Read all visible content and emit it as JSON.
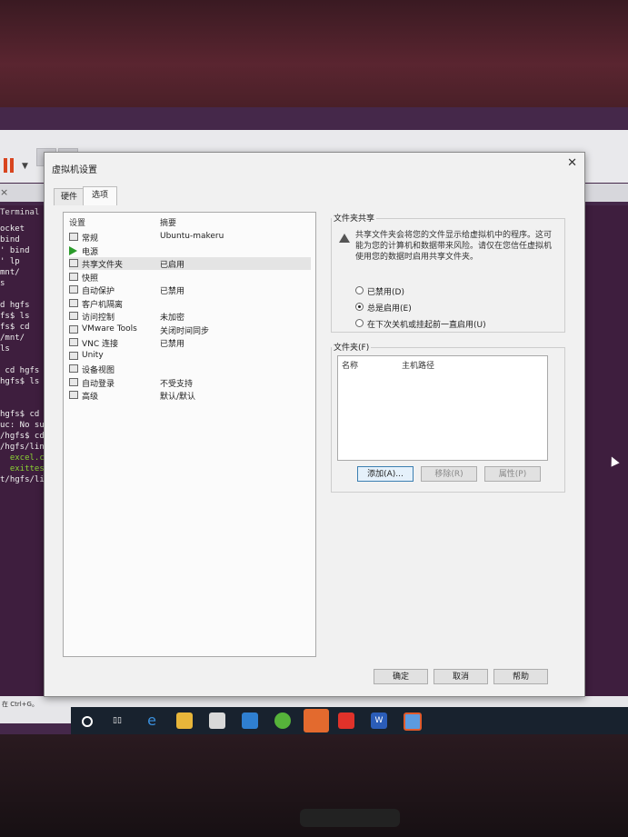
{
  "terminal": {
    "title": "Terminal  H",
    "lines": [
      {
        "text": "ocket",
        "color": "white"
      },
      {
        "text": "bind",
        "color": "white"
      },
      {
        "text": "' bind",
        "color": "white"
      },
      {
        "text": "' lp",
        "color": "white"
      },
      {
        "text": "mnt/",
        "color": "white"
      },
      {
        "text": "s",
        "color": "white"
      },
      {
        "text": "",
        "color": "white"
      },
      {
        "text": "d hgfs",
        "color": "white"
      },
      {
        "text": "fs$ ls",
        "color": "white"
      },
      {
        "text": "fs$ cd",
        "color": "white"
      },
      {
        "text": "/mnt/",
        "color": "white"
      },
      {
        "text": "ls",
        "color": "white"
      },
      {
        "text": "",
        "color": "white"
      },
      {
        "text": " cd hgfs",
        "color": "white"
      },
      {
        "text": "hgfs$ ls",
        "color": "white"
      },
      {
        "text": "",
        "color": "white"
      },
      {
        "text": "",
        "color": "white"
      },
      {
        "text": "hgfs$ cd lin",
        "color": "white"
      },
      {
        "text": "uc: No such",
        "color": "white"
      },
      {
        "text": "/hgfs$ cd lin",
        "color": "white"
      },
      {
        "text": "/hgfs/linuxsh",
        "color": "white"
      },
      {
        "text": "  excel.c   c",
        "color": "green"
      },
      {
        "text": "  exittest  f",
        "color": "green"
      },
      {
        "text": "t/hgfs/linuxsh",
        "color": "white"
      }
    ]
  },
  "status_bar": {
    "text": "在 Ctrl+G。"
  },
  "dialog": {
    "title": "虚拟机设置",
    "tabs": [
      "硬件",
      "选项"
    ],
    "columns": {
      "setting": "设置",
      "summary": "摘要"
    },
    "settings": [
      {
        "name": "常规",
        "summary": "Ubuntu-makeru",
        "icon": "monitor-icon"
      },
      {
        "name": "电源",
        "summary": "",
        "icon": "power-play-icon"
      },
      {
        "name": "共享文件夹",
        "summary": "已启用",
        "icon": "shared-folder-icon"
      },
      {
        "name": "快照",
        "summary": "",
        "icon": "snapshot-icon"
      },
      {
        "name": "自动保护",
        "summary": "已禁用",
        "icon": "autoprotect-icon"
      },
      {
        "name": "客户机隔离",
        "summary": "",
        "icon": "isolation-icon"
      },
      {
        "name": "访问控制",
        "summary": "未加密",
        "icon": "access-control-icon"
      },
      {
        "name": "VMware Tools",
        "summary": "关闭时间同步",
        "icon": "vmware-tools-icon"
      },
      {
        "name": "VNC 连接",
        "summary": "已禁用",
        "icon": "vnc-icon"
      },
      {
        "name": "Unity",
        "summary": "",
        "icon": "unity-icon"
      },
      {
        "name": "设备视图",
        "summary": "",
        "icon": "device-view-icon"
      },
      {
        "name": "自动登录",
        "summary": "不受支持",
        "icon": "autologin-icon"
      },
      {
        "name": "高级",
        "summary": "默认/默认",
        "icon": "advanced-icon"
      }
    ],
    "sharing": {
      "group_label": "文件夹共享",
      "warning": "共享文件夹会将您的文件显示给虚拟机中的程序。这可能为您的计算机和数据带来风险。请仅在您信任虚拟机使用您的数据时启用共享文件夹。",
      "options": [
        {
          "label": "已禁用(D)",
          "selected": false
        },
        {
          "label": "总是启用(E)",
          "selected": true
        },
        {
          "label": "在下次关机或挂起前一直启用(U)",
          "selected": false
        }
      ]
    },
    "folders": {
      "group_label": "文件夹(F)",
      "columns": [
        "名称",
        "主机路径"
      ],
      "add_label": "添加(A)...",
      "remove_label": "移除(R)",
      "properties_label": "属性(P)"
    },
    "footer": {
      "ok_label": "确定",
      "cancel_label": "取消",
      "help_label": "帮助"
    }
  },
  "taskbar": {
    "items": [
      "cortana-icon",
      "taskview-icon",
      "edge-icon",
      "explorer-icon",
      "store-icon",
      "mail-icon",
      "wechat-icon",
      "chat-icon",
      "app-red-icon",
      "word-icon",
      "vmware-icon"
    ]
  },
  "colors": {
    "terminal_bg": "#3e1e3e",
    "terminal_green": "#8ad234",
    "pause_orange": "#d8451f"
  }
}
